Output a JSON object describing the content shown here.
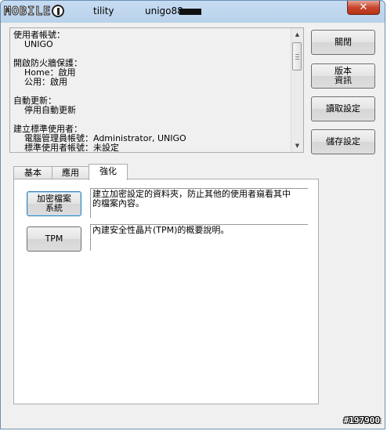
{
  "titlebar": {
    "logo_text": "MOBILE",
    "title_suffix": "tility",
    "user": "unigo88",
    "close_label": "✕",
    "logo_icon": "mobile01-logo"
  },
  "info": {
    "lines": [
      "使用者帳號：",
      "    UNIGO",
      "",
      "開啟防火牆保護：",
      "    Home：啟用",
      "    公用：啟用",
      "",
      "自動更新：",
      "    停用自動更新",
      "",
      "建立標準使用者：",
      "    電腦管理員帳號：Administrator, UNIGO",
      "    標準使用者帳號：未設定"
    ]
  },
  "side_buttons": [
    {
      "label": "關閉"
    },
    {
      "label": "版本\n資訊"
    },
    {
      "label": "讀取設定"
    },
    {
      "label": "儲存設定"
    }
  ],
  "tabs": [
    {
      "label": "基本"
    },
    {
      "label": "應用"
    },
    {
      "label": "強化"
    }
  ],
  "features": [
    {
      "label": "加密檔案\n系統",
      "description": "建立加密設定的資料夾，防止其他的使用者窺看其中\n的檔案內容。"
    },
    {
      "label": "TPM",
      "description": "內建安全性晶片(TPM)的概要說明。"
    }
  ],
  "watermark": "#197900"
}
